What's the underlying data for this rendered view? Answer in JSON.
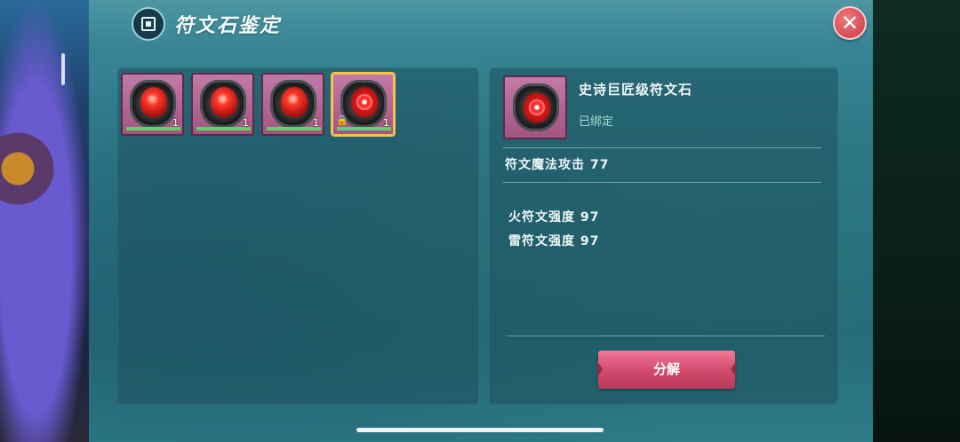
{
  "dialog": {
    "title": "符文石鉴定",
    "title_icon": "appraise-frame-icon",
    "close_icon": "close-icon",
    "close_label": "✕"
  },
  "inventory": {
    "slots": [
      {
        "count": "1",
        "locked": false,
        "selected": false,
        "icon": "fire-rune-icon"
      },
      {
        "count": "1",
        "locked": false,
        "selected": false,
        "icon": "fire-rune-icon"
      },
      {
        "count": "1",
        "locked": false,
        "selected": false,
        "icon": "fire-rune-icon"
      },
      {
        "count": "1",
        "locked": true,
        "selected": true,
        "icon": "epic-rune-icon"
      }
    ],
    "lock_icon": "lock-icon"
  },
  "detail": {
    "name": "史诗巨匠级符文石",
    "bound_status": "已绑定",
    "main_stat": "符文魔法攻击 77",
    "sub_stats": [
      "火符文强度 97",
      "雷符文强度 97"
    ],
    "decompose_label": "分解"
  },
  "colors": {
    "slot_bg": "#b2668f",
    "selected_border": "#f5c24a",
    "durability_bar": "#63d26a",
    "button": "#d1496a"
  }
}
